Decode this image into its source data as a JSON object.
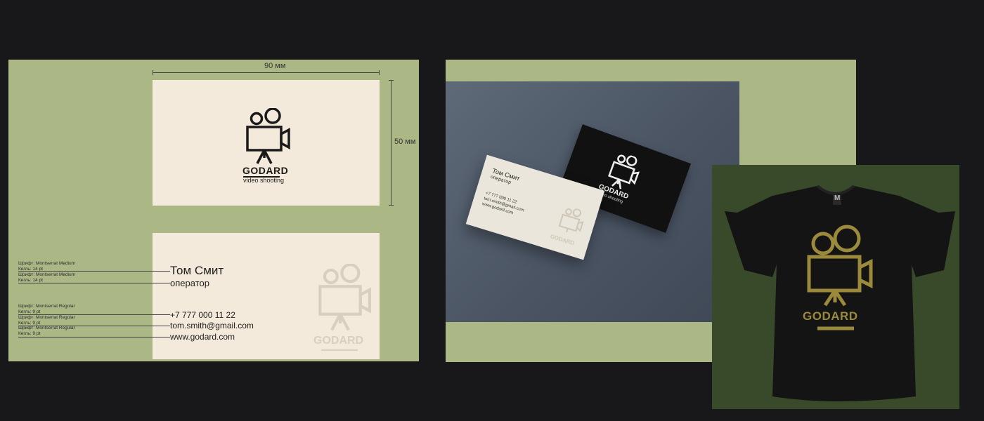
{
  "brand": {
    "name": "GODARD",
    "tagline": "video shooting"
  },
  "dimensions": {
    "width": "90 мм",
    "height": "50 мм"
  },
  "contact": {
    "name": "Том Смит",
    "role": "оператор",
    "phone": "+7 777 000 11 22",
    "email": "tom.smith@gmail.com",
    "website": "www.godard.com"
  },
  "mock_contact": {
    "phone": "+7 777 000 11 22",
    "email": "tom.smith@gmail.com",
    "website": "www.godard.com"
  },
  "specs": [
    {
      "font": "Шрифт: Montserrat Medium",
      "size": "Кегль: 14 pt"
    },
    {
      "font": "Шрифт: Montserrat Medium",
      "size": "Кегль: 14 pt"
    },
    {
      "font": "Шрифт: Montserrat Regular",
      "size": "Кегль: 9 pt"
    },
    {
      "font": "Шрифт: Montserrat Regular",
      "size": "Кегль: 9 pt"
    },
    {
      "font": "Шрифт: Montserrat Regular",
      "size": "Кегль: 9 pt"
    }
  ],
  "tshirt": {
    "label": "M"
  },
  "colors": {
    "background": "#18181a",
    "sage": "#abb785",
    "card": "#f4eadb",
    "ink": "#1a1a1a",
    "tshirt_bg": "#394a2b",
    "gold": "#9c8a3c"
  },
  "icons": [
    "camera-logo-icon"
  ]
}
